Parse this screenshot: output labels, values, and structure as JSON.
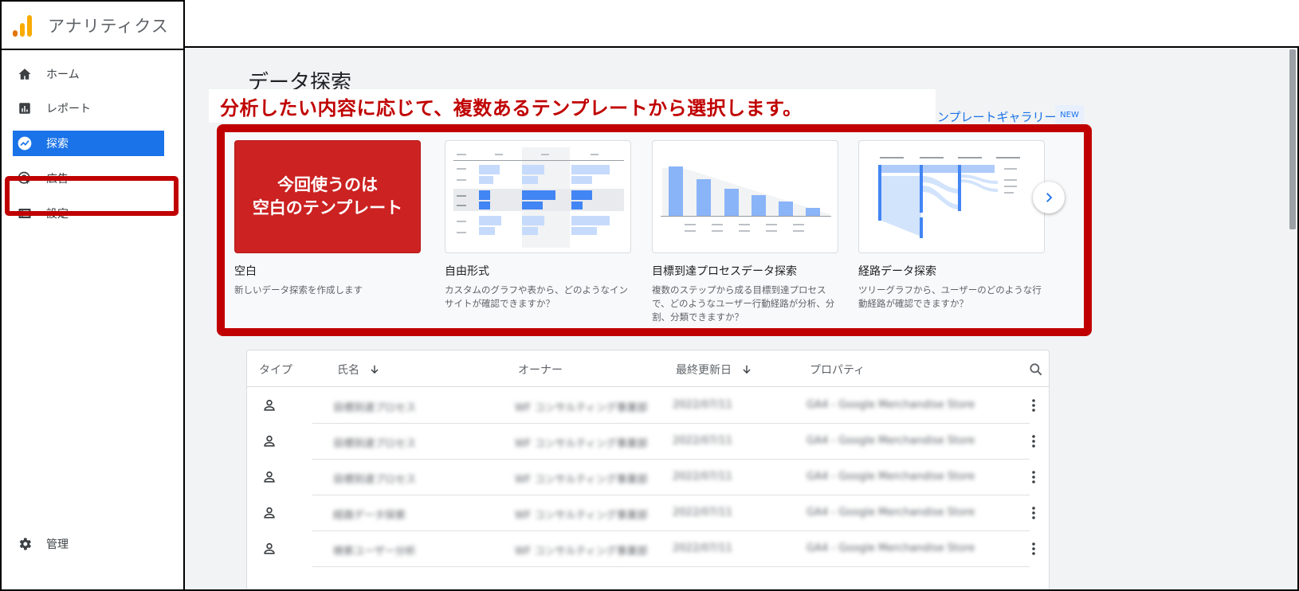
{
  "app": {
    "title": "アナリティクス",
    "logo_icon": "analytics-logo-icon"
  },
  "nav": {
    "items": [
      {
        "label": "ホーム",
        "icon": "home-icon"
      },
      {
        "label": "レポート",
        "icon": "reports-icon"
      },
      {
        "label": "探索",
        "icon": "explore-icon",
        "active": true
      },
      {
        "label": "広告",
        "icon": "advertising-icon"
      },
      {
        "label": "設定",
        "icon": "configure-icon"
      }
    ],
    "admin": {
      "label": "管理",
      "icon": "gear-icon"
    }
  },
  "page": {
    "title": "データ探索",
    "annotation": "分析したい内容に応じて、複数あるテンプレートから選択します。",
    "gallery_link": "ンプレートギャラリー",
    "new_badge": "NEW"
  },
  "templates": [
    {
      "title": "空白",
      "description": "新しいデータ探索を作成します",
      "overlay_line1": "今回使うのは",
      "overlay_line2": "空白のテンプレート"
    },
    {
      "title": "自由形式",
      "description": "カスタムのグラフや表から、どのようなインサイトが確認できますか？"
    },
    {
      "title": "目標到達プロセスデータ探索",
      "description": "複数のステップから成る目標到達プロセスで、どのようなユーザー行動経路が分析、分割、分類できますか？"
    },
    {
      "title": "経路データ探索",
      "description": "ツリーグラフから、ユーザーのどのような行動経路が確認できますか？"
    }
  ],
  "table": {
    "headers": {
      "type": "タイプ",
      "name": "氏名",
      "owner": "オーナー",
      "modified": "最終更新日",
      "property": "プロパティ"
    },
    "rows": [
      {
        "name": "目標到達プロセス",
        "owner": "WF コンサルティング事業部",
        "modified": "2022/07/11",
        "property": "GA4 - Google Merchandise Store"
      },
      {
        "name": "目標到達プロセス",
        "owner": "WF コンサルティング事業部",
        "modified": "2022/07/11",
        "property": "GA4 - Google Merchandise Store"
      },
      {
        "name": "目標到達プロセス",
        "owner": "WF コンサルティング事業部",
        "modified": "2022/07/11",
        "property": "GA4 - Google Merchandise Store"
      },
      {
        "name": "経路データ探索",
        "owner": "WF コンサルティング事業部",
        "modified": "2022/07/11",
        "property": "GA4 - Google Merchandise Store"
      },
      {
        "name": "検索ユーザー分析",
        "owner": "WF コンサルティング事業部",
        "modified": "2022/07/11",
        "property": "GA4 - Google Merchandise Store"
      }
    ]
  },
  "colors": {
    "accent": "#1a73e8",
    "annotation_red": "#c00000",
    "logo_orange": "#f9ab00",
    "logo_dark_orange": "#e37400"
  }
}
